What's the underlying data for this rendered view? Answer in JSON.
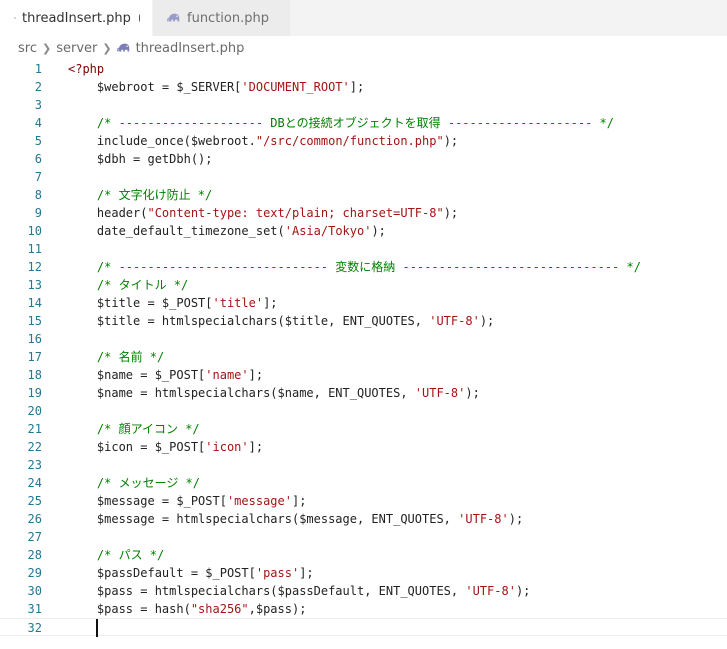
{
  "tabs": [
    {
      "label": "threadInsert.php",
      "active": true,
      "dirty": true
    },
    {
      "label": "function.php",
      "active": false,
      "dirty": false
    }
  ],
  "breadcrumb": [
    "src",
    "server",
    "threadInsert.php"
  ],
  "colors": {
    "php_icon": "#7b7fb5",
    "line_number": "#237893",
    "comment": "#008000",
    "string": "#a31515",
    "tag": "#800000"
  },
  "icons": {
    "tab": "php-elephant-icon",
    "separator": "chevron-right-icon"
  },
  "cursor_line": 32,
  "lines": [
    [
      {
        "t": "php",
        "v": "<?php"
      }
    ],
    [
      {
        "t": "plain",
        "v": "    $webroot = $_SERVER["
      },
      {
        "t": "str",
        "v": "'DOCUMENT_ROOT'"
      },
      {
        "t": "plain",
        "v": "];"
      }
    ],
    [],
    [
      {
        "t": "cm",
        "v": "    /* -------------------- DBとの接続オブジェクトを取得 -------------------- */"
      }
    ],
    [
      {
        "t": "plain",
        "v": "    include_once($webroot."
      },
      {
        "t": "str",
        "v": "\"/src/common/function.php\""
      },
      {
        "t": "plain",
        "v": ");"
      }
    ],
    [
      {
        "t": "plain",
        "v": "    $dbh = getDbh();"
      }
    ],
    [],
    [
      {
        "t": "cm",
        "v": "    /* 文字化け防止 */"
      }
    ],
    [
      {
        "t": "plain",
        "v": "    header("
      },
      {
        "t": "str",
        "v": "\"Content-type: text/plain; charset=UTF-8\""
      },
      {
        "t": "plain",
        "v": ");"
      }
    ],
    [
      {
        "t": "plain",
        "v": "    date_default_timezone_set("
      },
      {
        "t": "str",
        "v": "'Asia/Tokyo'"
      },
      {
        "t": "plain",
        "v": ");"
      }
    ],
    [],
    [
      {
        "t": "cm",
        "v": "    /* ----------------------------- 変数に格納 ------------------------------ */"
      }
    ],
    [
      {
        "t": "cm",
        "v": "    /* タイトル */"
      }
    ],
    [
      {
        "t": "plain",
        "v": "    $title = $_POST["
      },
      {
        "t": "str",
        "v": "'title'"
      },
      {
        "t": "plain",
        "v": "];"
      }
    ],
    [
      {
        "t": "plain",
        "v": "    $title = htmlspecialchars($title, ENT_QUOTES, "
      },
      {
        "t": "str",
        "v": "'UTF-8'"
      },
      {
        "t": "plain",
        "v": ");"
      }
    ],
    [],
    [
      {
        "t": "cm",
        "v": "    /* 名前 */"
      }
    ],
    [
      {
        "t": "plain",
        "v": "    $name = $_POST["
      },
      {
        "t": "str",
        "v": "'name'"
      },
      {
        "t": "plain",
        "v": "];"
      }
    ],
    [
      {
        "t": "plain",
        "v": "    $name = htmlspecialchars($name, ENT_QUOTES, "
      },
      {
        "t": "str",
        "v": "'UTF-8'"
      },
      {
        "t": "plain",
        "v": ");"
      }
    ],
    [],
    [
      {
        "t": "cm",
        "v": "    /* 顔アイコン */"
      }
    ],
    [
      {
        "t": "plain",
        "v": "    $icon = $_POST["
      },
      {
        "t": "str",
        "v": "'icon'"
      },
      {
        "t": "plain",
        "v": "];"
      }
    ],
    [],
    [
      {
        "t": "cm",
        "v": "    /* メッセージ */"
      }
    ],
    [
      {
        "t": "plain",
        "v": "    $message = $_POST["
      },
      {
        "t": "str",
        "v": "'message'"
      },
      {
        "t": "plain",
        "v": "];"
      }
    ],
    [
      {
        "t": "plain",
        "v": "    $message = htmlspecialchars($message, ENT_QUOTES, "
      },
      {
        "t": "str",
        "v": "'UTF-8'"
      },
      {
        "t": "plain",
        "v": ");"
      }
    ],
    [],
    [
      {
        "t": "cm",
        "v": "    /* パス */"
      }
    ],
    [
      {
        "t": "plain",
        "v": "    $passDefault = $_POST["
      },
      {
        "t": "str",
        "v": "'pass'"
      },
      {
        "t": "plain",
        "v": "];"
      }
    ],
    [
      {
        "t": "plain",
        "v": "    $pass = htmlspecialchars($passDefault, ENT_QUOTES, "
      },
      {
        "t": "str",
        "v": "'UTF-8'"
      },
      {
        "t": "plain",
        "v": ");"
      }
    ],
    [
      {
        "t": "plain",
        "v": "    $pass = hash("
      },
      {
        "t": "str",
        "v": "\"sha256\""
      },
      {
        "t": "plain",
        "v": ",$pass);"
      }
    ],
    []
  ]
}
